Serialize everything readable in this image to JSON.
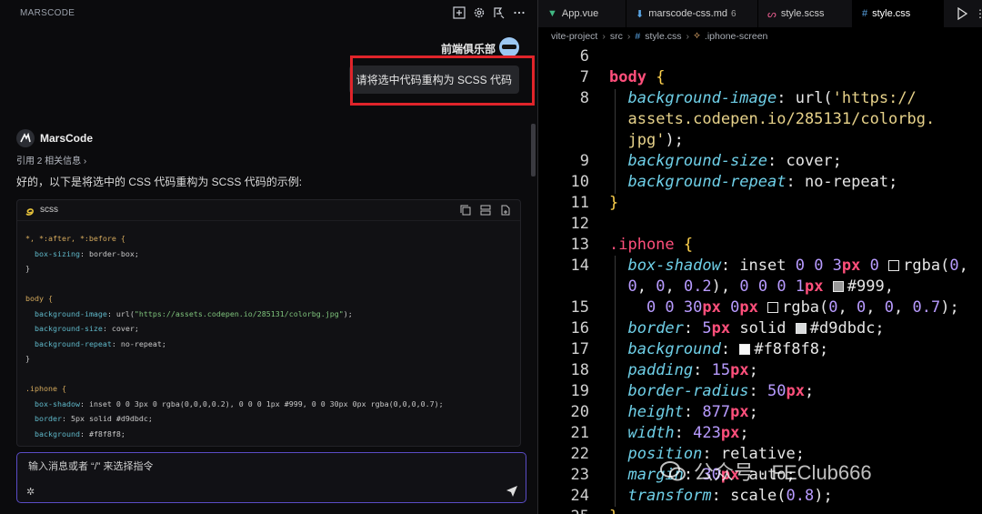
{
  "left_panel": {
    "brand": "MARSCODE",
    "header_icons": [
      "new-chat-icon",
      "settings-icon",
      "feedback-icon",
      "more-icon"
    ],
    "user": {
      "name": "前端俱乐部",
      "message": "请将选中代码重构为 SCSS 代码"
    },
    "assistant": {
      "name": "MarsCode",
      "reference": "引用 2 相关信息",
      "reply": "好的，以下是将选中的 CSS 代码重构为 SCSS 代码的示例:",
      "code_lang": "scss",
      "code_lines": [
        "*, *:after, *:before {",
        "  box-sizing: border-box;",
        "}",
        "",
        "body {",
        "  background-image: url(\"https://assets.codepen.io/285131/colorbg.jpg\");",
        "  background-size: cover;",
        "  background-repeat: no-repeat;",
        "}",
        "",
        ".iphone {",
        "  box-shadow: inset 0 0 3px 0 rgba(0,0,0,0.2), 0 0 0 1px #999, 0 0 30px 0px rgba(0,0,0,0.7);",
        "  border: 5px solid #d9dbdc;",
        "  background: #f8f8f8;"
      ]
    },
    "input": {
      "placeholder": "输入消息或者 “/” 来选择指令"
    }
  },
  "editor": {
    "tabs": [
      {
        "label": "App.vue",
        "icon": "vue-icon",
        "badge": ""
      },
      {
        "label": "marscode-css.md",
        "icon": "markdown-icon",
        "badge": "6"
      },
      {
        "label": "style.scss",
        "icon": "scss-icon",
        "badge": ""
      },
      {
        "label": "style.css",
        "icon": "css-icon",
        "badge": ""
      }
    ],
    "breadcrumb": [
      "vite-project",
      "src",
      "style.css",
      ".iphone-screen"
    ],
    "line_numbers": [
      "6",
      "7",
      "8",
      "",
      "",
      "9",
      "10",
      "11",
      "12",
      "13",
      "14",
      "",
      "15",
      "16",
      "17",
      "18",
      "19",
      "20",
      "21",
      "22",
      "23",
      "24",
      "25"
    ],
    "swatch_colors": {
      "rgba1": "#000000",
      "c999": "#999999",
      "rgba2": "#000000",
      "d9dbdc": "#d9dbdc",
      "f8f8f8": "#f8f8f8"
    }
  },
  "watermark": "公众号 · FEClub666",
  "colors": {
    "highlight_box": "#e0242a",
    "input_border": "#5a4cc6",
    "keyword": "#ff4f7b",
    "property": "#6fd0e8"
  }
}
